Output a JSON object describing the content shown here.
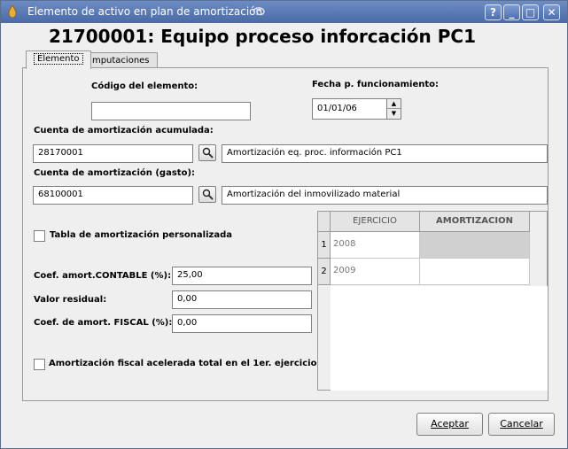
{
  "window": {
    "title": "Elemento de activo en plan de amortización",
    "buttons": {
      "help": "?",
      "minimize": "_",
      "maximize": "□",
      "close": "✕"
    }
  },
  "heading": "21700001: Equipo proceso inforcación PC1",
  "tabs": [
    {
      "label": "Elemento",
      "active": true
    },
    {
      "label": "Imputaciones",
      "active": false
    }
  ],
  "form": {
    "codigo_label": "Código del elemento:",
    "codigo_value": "",
    "fecha_label": "Fecha p. funcionamiento:",
    "fecha_value": "01/01/06",
    "cuenta_acum_label": "Cuenta de amortización acumulada:",
    "cuenta_acum_code": "28170001",
    "cuenta_acum_desc": "Amortización eq. proc. información PC1",
    "cuenta_gasto_label": "Cuenta de amortización (gasto):",
    "cuenta_gasto_code": "68100001",
    "cuenta_gasto_desc": "Amortización del inmovilizado material",
    "tabla_personalizada_label": "Tabla de amortización personalizada",
    "tabla_personalizada_checked": false,
    "coef_contable_label": "Coef. amort.CONTABLE (%):",
    "coef_contable_value": "25,00",
    "valor_residual_label": "Valor residual:",
    "valor_residual_value": "0,00",
    "coef_fiscal_label": "Coef. de amort. FISCAL (%):",
    "coef_fiscal_value": "0,00",
    "fiscal_acelerada_label": "Amortización fiscal acelerada total en el 1er. ejercicio",
    "fiscal_acelerada_checked": false
  },
  "table": {
    "columns": [
      "EJERCICIO",
      "AMORTIZACION"
    ],
    "rows": [
      {
        "num": "1",
        "ejercicio": "2008",
        "amortizacion": ""
      },
      {
        "num": "2",
        "ejercicio": "2009",
        "amortizacion": ""
      }
    ]
  },
  "footer": {
    "accept_label": "Aceptar",
    "cancel_label": "Cancelar"
  },
  "icons": {
    "app": "app-icon",
    "lookup": "magnifier-icon",
    "spin_up": "arrow-up-icon",
    "spin_down": "arrow-down-icon"
  }
}
